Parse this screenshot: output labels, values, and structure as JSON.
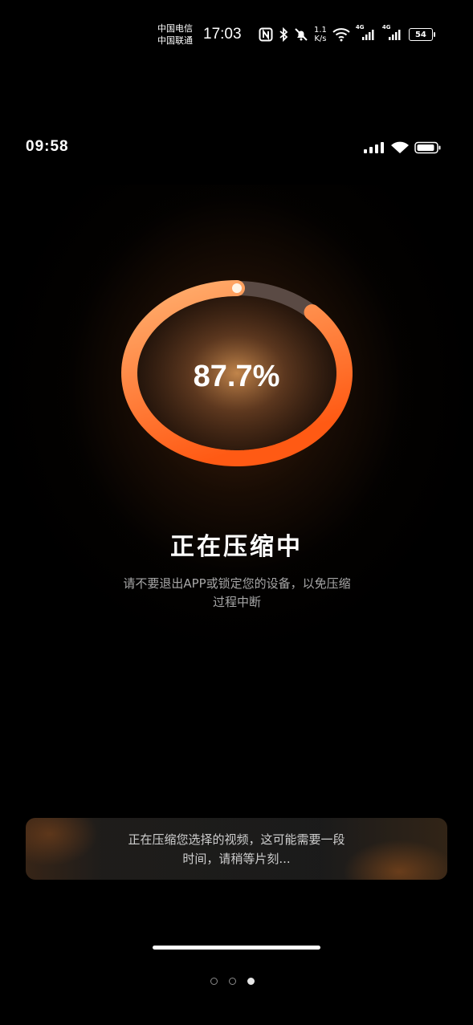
{
  "system_status": {
    "carrier_1": "中国电信",
    "carrier_2": "中国联通",
    "time": "17:03",
    "net_speed_value": "1.1",
    "net_speed_unit": "K/s",
    "network_tag_1": "4G",
    "network_tag_2": "4G",
    "battery": "54",
    "icons": [
      "nfc-icon",
      "bluetooth-icon",
      "mute-bell-icon",
      "wifi-icon",
      "signal-icon",
      "battery-icon"
    ]
  },
  "app_status": {
    "time": "09:58",
    "icons": [
      "signal-icon",
      "wifi-icon",
      "battery-icon"
    ]
  },
  "progress": {
    "value": 0.877,
    "label": "87.7%",
    "track_color": "#5a4a44",
    "fill_color_start": "#ffb070",
    "fill_color_end": "#ff5a14"
  },
  "main": {
    "title": "正在压缩中",
    "subtitle_line1": "请不要退出APP或锁定您的设备，以免压缩",
    "subtitle_line2": "过程中断"
  },
  "info_card": {
    "line1": "正在压缩您选择的视频，这可能需要一段",
    "line2": "时间，请稍等片刻..."
  },
  "pagination": {
    "count": 3,
    "active_index": 2
  }
}
